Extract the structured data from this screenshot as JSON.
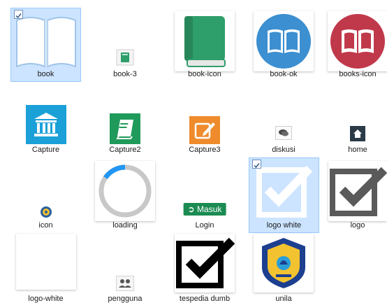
{
  "files": [
    {
      "name": "book",
      "selected": true,
      "checked": true,
      "icon": "open-book-icon"
    },
    {
      "name": "book-3",
      "selected": false,
      "checked": false,
      "icon": "small-book-icon"
    },
    {
      "name": "book-icon",
      "selected": false,
      "checked": false,
      "icon": "green-book-icon"
    },
    {
      "name": "book-ok",
      "selected": false,
      "checked": false,
      "icon": "blue-circle-book-icon"
    },
    {
      "name": "books-icon",
      "selected": false,
      "checked": false,
      "icon": "red-circle-book-icon"
    },
    {
      "name": "Capture",
      "selected": false,
      "checked": false,
      "icon": "bank-icon"
    },
    {
      "name": "Capture2",
      "selected": false,
      "checked": false,
      "icon": "notebook-icon"
    },
    {
      "name": "Capture3",
      "selected": false,
      "checked": false,
      "icon": "edit-icon"
    },
    {
      "name": "diskusi",
      "selected": false,
      "checked": false,
      "icon": "chat-icon"
    },
    {
      "name": "home",
      "selected": false,
      "checked": false,
      "icon": "home-icon"
    },
    {
      "name": "icon",
      "selected": false,
      "checked": false,
      "icon": "seal-icon"
    },
    {
      "name": "loading",
      "selected": false,
      "checked": false,
      "icon": "loading-ring-icon"
    },
    {
      "name": "Login",
      "selected": false,
      "checked": false,
      "icon": "login-button-icon",
      "button_text": "Masuk"
    },
    {
      "name": "logo white",
      "selected": true,
      "checked": true,
      "icon": "white-checkmark-icon"
    },
    {
      "name": "logo",
      "selected": false,
      "checked": false,
      "icon": "gray-checkmark-icon"
    },
    {
      "name": "logo-white",
      "selected": false,
      "checked": false,
      "icon": "blank-image-icon"
    },
    {
      "name": "pengguna",
      "selected": false,
      "checked": false,
      "icon": "users-icon"
    },
    {
      "name": "tespedia dumb",
      "selected": false,
      "checked": false,
      "icon": "black-checkmark-icon"
    },
    {
      "name": "unila",
      "selected": false,
      "checked": false,
      "icon": "university-seal-icon"
    }
  ],
  "colors": {
    "selection": "#cce4ff",
    "green": "#2e9e6a",
    "blue": "#3c8fd0",
    "red": "#c0394b",
    "teal": "#1ba0d8",
    "orange": "#ef8b2c",
    "loading_blue": "#2196f3",
    "login_green": "#1b8b52"
  }
}
